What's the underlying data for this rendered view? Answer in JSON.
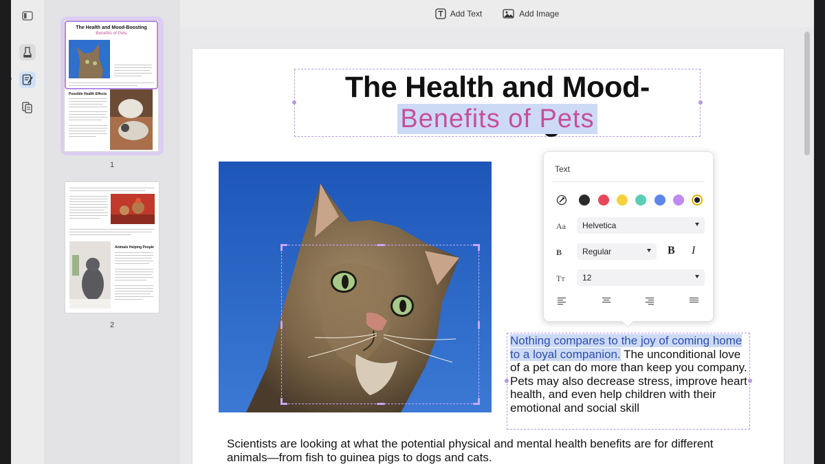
{
  "toolbar": {
    "add_text_label": "Add Text",
    "add_image_label": "Add Image"
  },
  "thumbnails": {
    "pages": [
      {
        "number": "1",
        "title": "The Health and Mood-Boosting",
        "subtitle": "Benefits of Pets",
        "section": "Possible Health Effects",
        "selected": true
      },
      {
        "number": "2",
        "section": "Animals Helping People",
        "selected": false
      }
    ]
  },
  "document": {
    "title_line1": "The Health and Mood-Boosting",
    "title_line2": "Benefits  of Pets",
    "body_highlight": "Nothing compares to the joy of coming home to a loyal companion.",
    "body_rest": " The unconditional love of a pet can do more than keep you company. Pets may also decrease stress, improve heart health,  and  even  help children  with  their emotional and social skill",
    "paragraph": "Scientists are looking at what the potential physical and mental health benefits are for different animals—from fish to guinea pigs to dogs and cats."
  },
  "text_panel": {
    "title": "Text",
    "colors": [
      "#2b2b2b",
      "#e8475a",
      "#f5d23c",
      "#5ccdb6",
      "#5b86ea",
      "#c08af0",
      "#1b1b1b"
    ],
    "font_family": "Helvetica",
    "font_weight": "Regular",
    "font_size": "12",
    "bold_label": "B",
    "italic_label": "I",
    "font_row_icon": "Aa",
    "weight_row_icon": "B",
    "size_row_icon": "Tт"
  },
  "accent": {
    "selection": "#b59ae0",
    "highlight_bg": "#cddaf5",
    "pink_title": "#c64f9a"
  }
}
